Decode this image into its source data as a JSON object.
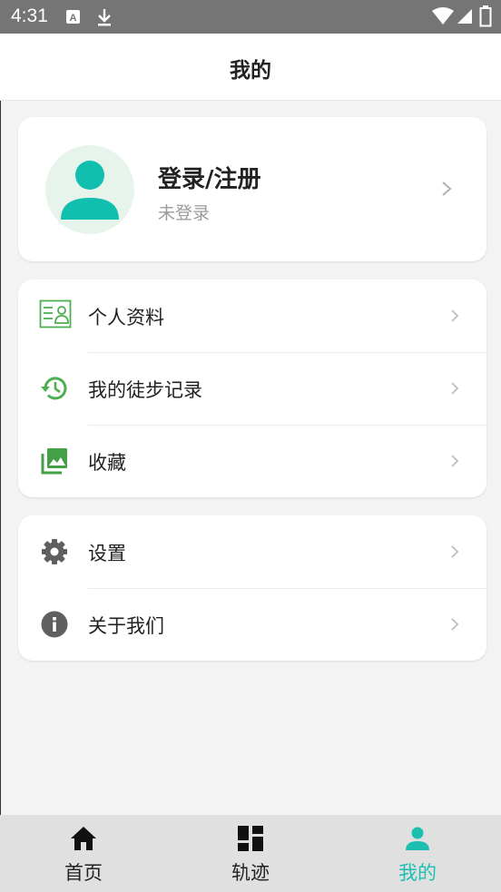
{
  "status_bar": {
    "time": "4:31"
  },
  "header": {
    "title": "我的"
  },
  "profile": {
    "name": "登录/注册",
    "status": "未登录"
  },
  "menu_group_1": [
    {
      "label": "个人资料",
      "icon": "id-card-icon"
    },
    {
      "label": "我的徒步记录",
      "icon": "history-icon"
    },
    {
      "label": "收藏",
      "icon": "gallery-icon"
    }
  ],
  "menu_group_2": [
    {
      "label": "设置",
      "icon": "gear-icon"
    },
    {
      "label": "关于我们",
      "icon": "info-icon"
    }
  ],
  "tabs": [
    {
      "label": "首页",
      "icon": "home-icon"
    },
    {
      "label": "轨迹",
      "icon": "dashboard-icon"
    },
    {
      "label": "我的",
      "icon": "person-icon",
      "active": true
    }
  ],
  "colors": {
    "accent": "#1cbfb0",
    "green_icon": "#4caf50",
    "avatar_bg": "#e6f4ec"
  }
}
